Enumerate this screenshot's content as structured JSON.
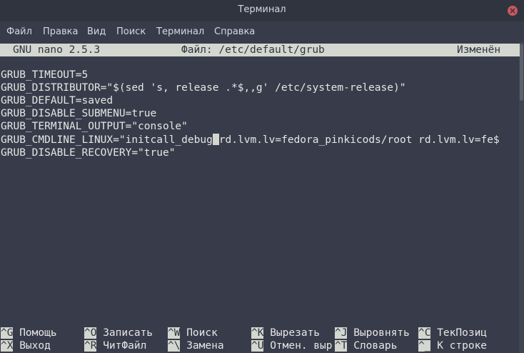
{
  "window": {
    "title": "Терминал"
  },
  "menu": [
    "Файл",
    "Правка",
    "Вид",
    "Поиск",
    "Терминал",
    "Справка"
  ],
  "nano": {
    "version": "GNU nano 2.5.3",
    "file": "Файл: /etc/default/grub",
    "status": "Изменён"
  },
  "lines": [
    "GRUB_TIMEOUT=5",
    "GRUB_DISTRIBUTOR=\"$(sed 's, release .*$,,g' /etc/system-release)\"",
    "GRUB_DEFAULT=saved",
    "GRUB_DISABLE_SUBMENU=true",
    "GRUB_TERMINAL_OUTPUT=\"console\"",
    "GRUB_DISABLE_RECOVERY=\"true\""
  ],
  "cmdline": {
    "before": "GRUB_CMDLINE_LINUX=\"initcall_debug",
    "after": "rd.lvm.lv=fedora_pinkicods/root rd.lvm.lv=fe$"
  },
  "shortcuts": {
    "row1": [
      {
        "key": "^G",
        "label": "Помощь"
      },
      {
        "key": "^O",
        "label": "Записать"
      },
      {
        "key": "^W",
        "label": "Поиск"
      },
      {
        "key": "^K",
        "label": "Вырезать"
      },
      {
        "key": "^J",
        "label": "Выровнять"
      },
      {
        "key": "^C",
        "label": "ТекПозиц"
      }
    ],
    "row2": [
      {
        "key": "^X",
        "label": "Выход"
      },
      {
        "key": "^R",
        "label": "ЧитФайл"
      },
      {
        "key": "^\\",
        "label": "Замена"
      },
      {
        "key": "^U",
        "label": "Отмен. выр"
      },
      {
        "key": "^T",
        "label": "Словарь"
      },
      {
        "key": "^_",
        "label": "К строке"
      }
    ]
  }
}
